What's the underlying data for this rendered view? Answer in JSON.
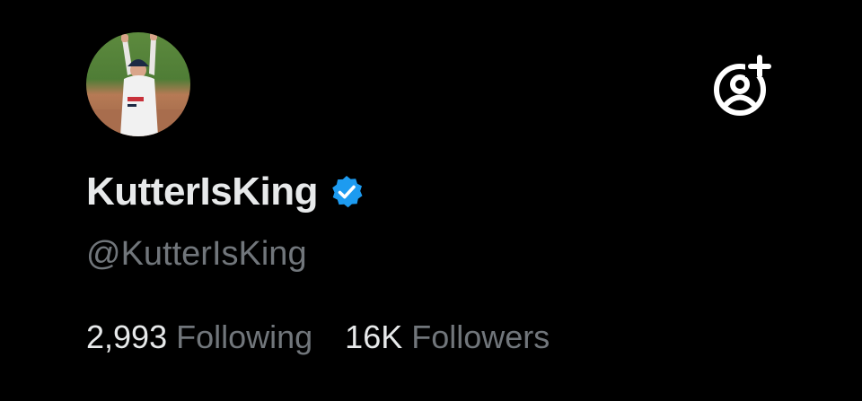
{
  "profile": {
    "display_name": "KutterIsKing",
    "handle": "@KutterIsKing",
    "verified": true,
    "avatar_icon": "avatar-photo",
    "following_count": "2,993",
    "following_label": "Following",
    "followers_count": "16K",
    "followers_label": "Followers"
  },
  "actions": {
    "follow_icon": "add-user-icon"
  },
  "colors": {
    "background": "#000000",
    "text_primary": "#e7e9ea",
    "text_secondary": "#71767b",
    "verified_blue": "#1d9bf0"
  }
}
